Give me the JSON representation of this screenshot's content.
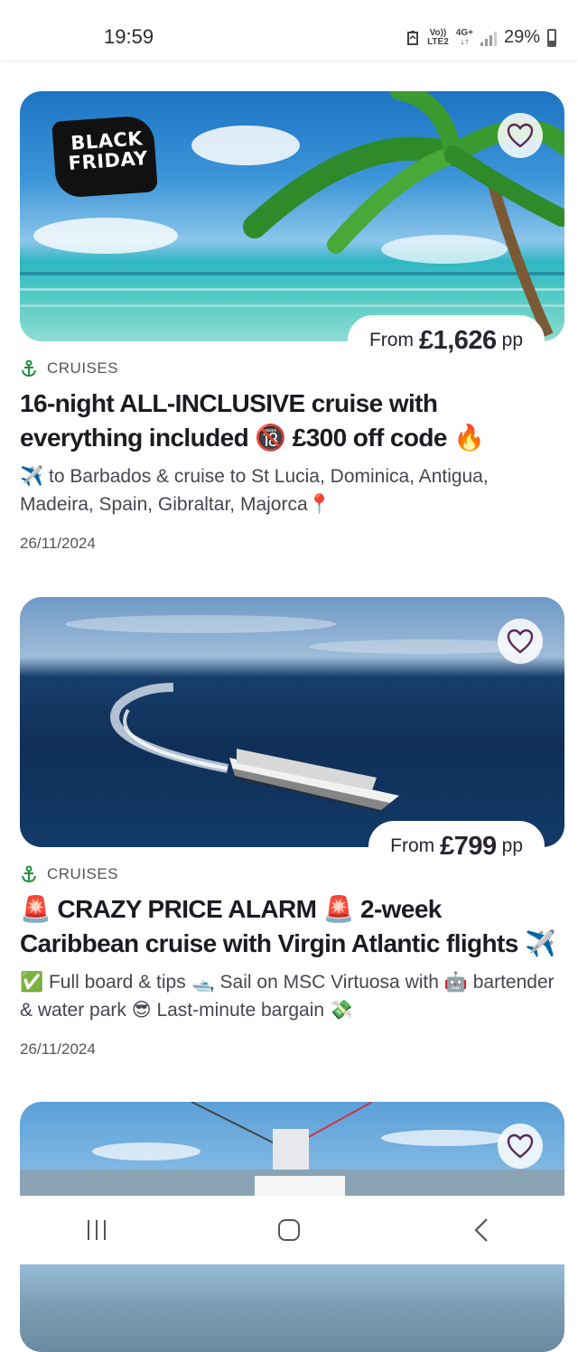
{
  "status_bar": {
    "time": "19:59",
    "network_top": "Vo))",
    "network_bottom": "LTE2",
    "data_top": "4G+",
    "data_bottom": "↓↑",
    "battery": "29%"
  },
  "cards": [
    {
      "badge": "BLACK FRIDAY",
      "price_prefix": "From",
      "price": "£1,626",
      "price_suffix": "pp",
      "category": "CRUISES",
      "title": "16-night ALL-INCLUSIVE cruise with everything included 🔞 £300 off code 🔥",
      "description": "✈️ to Barbados & cruise to St Lucia, Dominica, Antigua, Madeira, Spain, Gibraltar, Majorca📍",
      "date": "26/11/2024"
    },
    {
      "price_prefix": "From",
      "price": "£799",
      "price_suffix": "pp",
      "category": "CRUISES",
      "title": "🚨 CRAZY PRICE ALARM 🚨 2-week Caribbean cruise with Virgin Atlantic flights ✈️",
      "description": "✅ Full board & tips 🛥️ Sail on MSC Virtuosa with 🤖 bartender & water park 😎 Last-minute bargain 💸",
      "date": "26/11/2024"
    }
  ],
  "colors": {
    "accent": "#5b2a55",
    "category_icon": "#1f8f3a"
  }
}
